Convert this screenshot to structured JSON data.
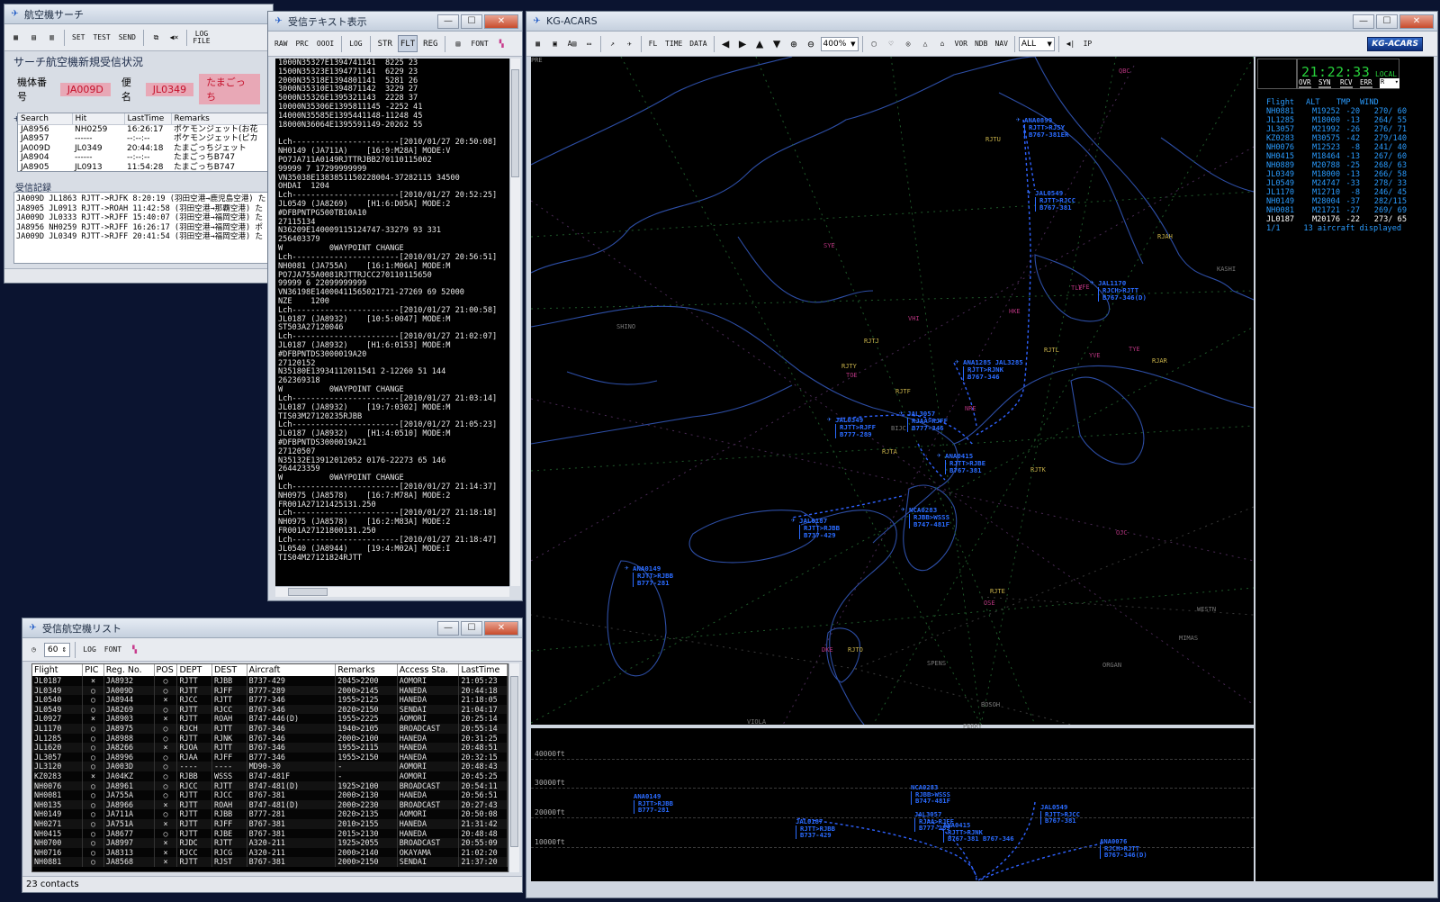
{
  "search": {
    "title": "航空機サーチ",
    "toolbar": [
      "SET",
      "TEST",
      "SEND",
      "LOG FILE"
    ],
    "group": "サーチ航空機新規受信状況",
    "reg_label": "機体番号",
    "reg_value": "JA009D",
    "flight_label": "便名",
    "flight_value": "JL0349",
    "remark_value": "たまごっち",
    "list_label": "サーチ航空機登録リスト",
    "columns": [
      "Search",
      "Hit",
      "LastTime",
      "Remarks"
    ],
    "rows": [
      [
        "JA8956",
        "NH0259",
        "16:26:17",
        "ポケモンジェット(お花"
      ],
      [
        "JA8957",
        "------",
        "--:--:--",
        "ポケモンジェット(ピカ"
      ],
      [
        "JA009D",
        "JL0349",
        "20:44:18",
        "たまごっちジェット"
      ],
      [
        "JA8904",
        "------",
        "--:--:--",
        "たまごっちB747"
      ],
      [
        "JA8905",
        "JL0913",
        "11:54:28",
        "たまごっちB747"
      ]
    ],
    "log_label": "受信記録",
    "log": [
      "JA009D JL1863 RJTT->RJFK 8:20:19 (羽田空港→鹿児島空港) た",
      "JA8905 JL0913 RJTT->ROAH 11:42:58 (羽田空港→那覇空港) た",
      "JA009D JL0333 RJTT->RJFF 15:40:07 (羽田空港→福岡空港) た",
      "JA8956 NH0259 RJTT->RJFF 16:26:17 (羽田空港→福岡空港) ポ",
      "JA009D JL0349 RJTT->RJFF 20:41:54 (羽田空港→福岡空港) た"
    ]
  },
  "text": {
    "title": "受信テキスト表示",
    "toolbar": [
      "RAW",
      "PRC",
      "OOOI",
      "LOG",
      "STR",
      "FLT",
      "REG",
      "FONT"
    ],
    "lines": [
      "1000N35327E1394741141  8225 23",
      "1500N35323E1394771141  6229 23",
      "2000N35318E1394801141  5281 26",
      "3000N35310E1394871142  3229 27",
      "5000N35326E1395321143  2228 37",
      "10000N35306E1395811145 -2252 41",
      "14000N35585E1395441148-11248 45",
      "18000N36064E1395591149-20262 55",
      "",
      "Lch-----------------------[2010/01/27 20:50:08]",
      "NH0149 (JA711A)    [16:9:M28A] MODE:V",
      "PO7JA711A0149RJTTRJBB270110115002",
      "99999 7 17299999999",
      "VN35038E1383851150228004-37282115 34500",
      "OHDAI  1204",
      "Lch-----------------------[2010/01/27 20:52:25]",
      "JL0549 (JA8269)    [H1:6:D05A] MODE:2",
      "#DFBPNTPG500TB10A10",
      "27115134",
      "N36209E140009115124747-33279 93 331",
      "256403379",
      "W          0WAYPOINT CHANGE",
      "Lch-----------------------[2010/01/27 20:56:51]",
      "NH0081 (JA755A)    [16:1:M06A] MODE:M",
      "PO7JA755A0081RJTTRJCC270110115650",
      "99999 6 22099999999",
      "VN36198E14000411565021721-27269 69 52000",
      "NZE    1200",
      "Lch-----------------------[2010/01/27 21:00:58]",
      "JL0187 (JA8932)    [10:5:0047] MODE:M",
      "ST503A27120046",
      "Lch-----------------------[2010/01/27 21:02:07]",
      "JL0187 (JA8932)    [H1:6:0153] MODE:M",
      "#DFBPNTDS3000019A20",
      "27120152",
      "N35180E13934112011541 2-12260 51 144",
      "262369318",
      "W          0WAYPOINT CHANGE",
      "Lch-----------------------[2010/01/27 21:03:14]",
      "JL0187 (JA8932)    [19:7:0302] MODE:M",
      "TIS03M27120235RJBB",
      "Lch-----------------------[2010/01/27 21:05:23]",
      "JL0187 (JA8932)    [H1:4:0510] MODE:M",
      "#DFBPNTDS3000019A21",
      "27120507",
      "N35132E13912012052 0176-22273 65 146",
      "264423359",
      "W          0WAYPOINT CHANGE",
      "Lch-----------------------[2010/01/27 21:14:37]",
      "NH0975 (JA8578)    [16:7:M78A] MODE:2",
      "FR001A27121425131.250",
      "Lch-----------------------[2010/01/27 21:18:18]",
      "NH0975 (JA8578)    [16:2:M83A] MODE:2",
      "FR001A27121800131.250",
      "Lch-----------------------[2010/01/27 21:18:47]",
      "JL0540 (JA8944)    [19:4:M02A] MODE:I",
      "TIS04M27121824RJTT"
    ]
  },
  "list": {
    "title": "受信航空機リスト",
    "interval": "60",
    "toolbar": [
      "LOG",
      "FONT"
    ],
    "columns": [
      "Flight",
      "PIC",
      "Reg. No.",
      "POS",
      "DEPT",
      "DEST",
      "Aircraft",
      "Remarks",
      "Access Sta.",
      "LastTime"
    ],
    "rows": [
      [
        "JL0187",
        "×",
        "JA8932",
        "○",
        "RJTT",
        "RJBB",
        "B737-429",
        "2045>2200",
        "AOMORI",
        "21:05:23"
      ],
      [
        "JL0349",
        "○",
        "JA009D",
        "○",
        "RJTT",
        "RJFF",
        "B777-289",
        "2000>2145",
        "HANEDA",
        "20:44:18"
      ],
      [
        "JL0540",
        "○",
        "JA8944",
        "×",
        "RJCC",
        "RJTT",
        "B777-346",
        "1955>2125",
        "HANEDA",
        "21:18:05"
      ],
      [
        "JL0549",
        "○",
        "JA8269",
        "○",
        "RJTT",
        "RJCC",
        "B767-346",
        "2020>2150",
        "SENDAI",
        "21:04:17"
      ],
      [
        "JL0927",
        "×",
        "JA8903",
        "×",
        "RJTT",
        "ROAH",
        "B747-446(D)",
        "1955>2225",
        "AOMORI",
        "20:25:14"
      ],
      [
        "JL1170",
        "○",
        "JA8975",
        "○",
        "RJCH",
        "RJTT",
        "B767-346",
        "1940>2105",
        "BROADCAST",
        "20:55:14"
      ],
      [
        "JL1285",
        "○",
        "JA8988",
        "○",
        "RJTT",
        "RJNK",
        "B767-346",
        "2000>2100",
        "HANEDA",
        "20:31:25"
      ],
      [
        "JL1620",
        "○",
        "JA8266",
        "×",
        "RJOA",
        "RJTT",
        "B767-346",
        "1955>2115",
        "HANEDA",
        "20:48:51"
      ],
      [
        "JL3057",
        "○",
        "JA8996",
        "○",
        "RJAA",
        "RJFF",
        "B777-346",
        "1955>2150",
        "HANEDA",
        "20:32:15"
      ],
      [
        "JL3120",
        "○",
        "JA003D",
        "○",
        "----",
        "----",
        "MD90-30",
        "-",
        "AOMORI",
        "20:48:43"
      ],
      [
        "KZ0283",
        "×",
        "JA04KZ",
        "○",
        "RJBB",
        "WSSS",
        "B747-481F",
        "-",
        "AOMORI",
        "20:45:25"
      ],
      [
        "NH0076",
        "○",
        "JA8961",
        "○",
        "RJCC",
        "RJTT",
        "B747-481(D)",
        "1925>2100",
        "BROADCAST",
        "20:54:11"
      ],
      [
        "NH0081",
        "○",
        "JA755A",
        "○",
        "RJTT",
        "RJCC",
        "B767-381",
        "2000>2130",
        "HANEDA",
        "20:56:51"
      ],
      [
        "NH0135",
        "○",
        "JA8966",
        "×",
        "RJTT",
        "ROAH",
        "B747-481(D)",
        "2000>2230",
        "BROADCAST",
        "20:27:43"
      ],
      [
        "NH0149",
        "○",
        "JA711A",
        "○",
        "RJTT",
        "RJBB",
        "B777-281",
        "2020>2135",
        "AOMORI",
        "20:50:08"
      ],
      [
        "NH0271",
        "○",
        "JA751A",
        "×",
        "RJTT",
        "RJFF",
        "B767-381",
        "2010>2155",
        "HANEDA",
        "21:31:42"
      ],
      [
        "NH0415",
        "○",
        "JA8677",
        "○",
        "RJTT",
        "RJBE",
        "B767-381",
        "2015>2130",
        "HANEDA",
        "20:48:48"
      ],
      [
        "NH0700",
        "○",
        "JA8997",
        "×",
        "RJDC",
        "RJTT",
        "A320-211",
        "1925>2055",
        "BROADCAST",
        "20:55:09"
      ],
      [
        "NH0716",
        "○",
        "JA8313",
        "×",
        "RJCC",
        "RJCG",
        "A320-211",
        "2000>2140",
        "OKAYAMA",
        "21:02:20"
      ],
      [
        "NH0881",
        "○",
        "JA8568",
        "×",
        "RJTT",
        "RJST",
        "B767-381",
        "2000>2150",
        "SENDAI",
        "21:37:20"
      ]
    ],
    "status": "23 contacts"
  },
  "acars": {
    "title": "KG-ACARS",
    "zoom": "400%",
    "filter": "ALL",
    "logo": "KG-ACARS",
    "time": "21:22:33",
    "time_label": "LOCAL",
    "flags": [
      "OVR",
      "SYN",
      "RCV",
      "ERR"
    ],
    "r_select": "R",
    "fp_header": [
      "Flight",
      "ALT",
      "TMP",
      "WIND"
    ],
    "fp_rows": [
      [
        "NH0881",
        "M19252",
        "-20",
        "270/ 60"
      ],
      [
        "JL1285",
        "M18000",
        "-13",
        "264/ 55"
      ],
      [
        "JL3057",
        "M21992",
        "-26",
        "276/ 71"
      ],
      [
        "KZ0283",
        "M30575",
        "-42",
        "279/140"
      ],
      [
        "NH0076",
        "M12523",
        "-8",
        "241/ 40"
      ],
      [
        "NH0415",
        "M18464",
        "-13",
        "267/ 60"
      ],
      [
        "NH0889",
        "M20788",
        "-25",
        "268/ 63"
      ],
      [
        "JL0349",
        "M18000",
        "-13",
        "266/ 58"
      ],
      [
        "JL0549",
        "M24747",
        "-33",
        "278/ 33"
      ],
      [
        "JL1170",
        "M12710",
        "-8",
        "246/ 45"
      ],
      [
        "NH0149",
        "M28004",
        "-37",
        "282/115"
      ],
      [
        "NH0081",
        "M21721",
        "-27",
        "269/ 69"
      ],
      [
        "JL0187",
        "M20176",
        "-22",
        "273/ 65"
      ]
    ],
    "fp_footer": "1/1     13 aircraft displayed",
    "alt_labels": [
      "40000ft",
      "30000ft",
      "20000ft",
      "10000ft"
    ],
    "airports": [
      "RJTU",
      "RJTJ",
      "RJTY",
      "RJTF",
      "RJTA",
      "RJTL",
      "RJTK",
      "RJAH",
      "RJAR",
      "RJTO",
      "RJTE",
      "KASHI",
      "SHINO",
      "SPENS",
      "BOSOH",
      "VIOLA",
      "PERRY",
      "MIMAS",
      "ORGAN",
      "WESTN",
      "BIJC",
      "OJC",
      "QBC",
      "SYE",
      "TLE",
      "VFE",
      "VHI",
      "TOE",
      "YVE",
      "TYE",
      "HKE",
      "NRE",
      "DKE",
      "OSE",
      "PRE"
    ],
    "aircraft": [
      {
        "call": "ANA0899",
        "route": "RJTT>RJSY",
        "type": "B767-381ER"
      },
      {
        "call": "JAL0549",
        "route": "RJTT>RJCC",
        "type": "B767-381"
      },
      {
        "call": "JAL1170",
        "route": "RJCH>RJTT",
        "type": "B767-346(D)"
      },
      {
        "call": "ANA1285 JAL3285",
        "route": "RJTT>RJNK",
        "type": "B767-346"
      },
      {
        "call": "JAL3057",
        "route": "RJAA>RJFF",
        "type": "B777-346"
      },
      {
        "call": "JAL0349",
        "route": "RJTT>RJFF",
        "type": "B777-289"
      },
      {
        "call": "ANA0415",
        "route": "RJTT>RJBE",
        "type": "B767-381"
      },
      {
        "call": "NCA0283",
        "route": "RJBB>WSSS",
        "type": "B747-481F"
      },
      {
        "call": "JAL0187",
        "route": "RJTT>RJBB",
        "type": "B737-429"
      },
      {
        "call": "ANA0149",
        "route": "RJTT>RJBB",
        "type": "B777-281"
      }
    ],
    "profile_aircraft": [
      {
        "call": "ANA0149",
        "route": "RJTT>RJBB",
        "type": "B777-281"
      },
      {
        "call": "NCA0283",
        "route": "RJBB>WSSS",
        "type": "B747-481F"
      },
      {
        "call": "JAL0187",
        "route": "RJTT>RJBB",
        "type": "B737-429"
      },
      {
        "call": "JAL3057",
        "route": "RJAA>RJFF",
        "type": "B777-289"
      },
      {
        "call": "ANA0415",
        "route": "RJTT>RJNK",
        "type": "B767-381 B767-346"
      },
      {
        "call": "JAL0549",
        "route": "RJTT>RJCC",
        "type": "B767-381"
      },
      {
        "call": "ANA0076",
        "route": "RJCH>RJTT",
        "type": "B767-346(D)"
      }
    ]
  }
}
